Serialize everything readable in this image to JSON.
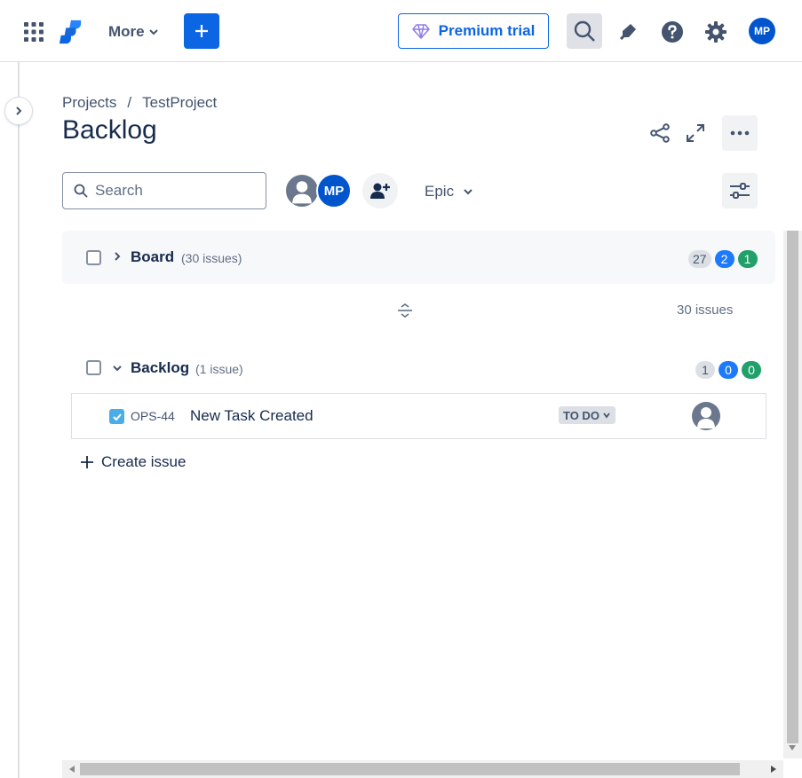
{
  "nav": {
    "more_label": "More",
    "premium_label": "Premium trial",
    "user_initials": "MP",
    "icons": [
      "app-switcher-icon",
      "jira-logo-icon",
      "chevron-down-icon",
      "plus-icon",
      "diamond-icon",
      "search-icon",
      "notification-icon",
      "help-icon",
      "settings-icon"
    ]
  },
  "header": {
    "breadcrumb": [
      "Projects",
      "TestProject"
    ],
    "breadcrumb_separator": "/",
    "title": "Backlog"
  },
  "filters": {
    "search_placeholder": "Search",
    "avatar_initials": "MP",
    "epic_label": "Epic"
  },
  "board": {
    "name": "Board",
    "issue_count": "(30 issues)",
    "counts": {
      "todo": "27",
      "in_progress": "2",
      "done": "1"
    },
    "total_label": "30 issues"
  },
  "backlog": {
    "name": "Backlog",
    "issue_count": "(1 issue)",
    "counts": {
      "todo": "1",
      "in_progress": "0",
      "done": "0"
    },
    "issues": [
      {
        "key": "OPS-44",
        "summary": "New Task Created",
        "status": "TO DO",
        "type": "task"
      }
    ],
    "create_label": "Create issue"
  },
  "colors": {
    "primary": "#0c66e4",
    "avatar_blue": "#0055cc",
    "count_blue": "#1d7afc",
    "count_green": "#22a06b",
    "task_icon": "#4bade8"
  }
}
